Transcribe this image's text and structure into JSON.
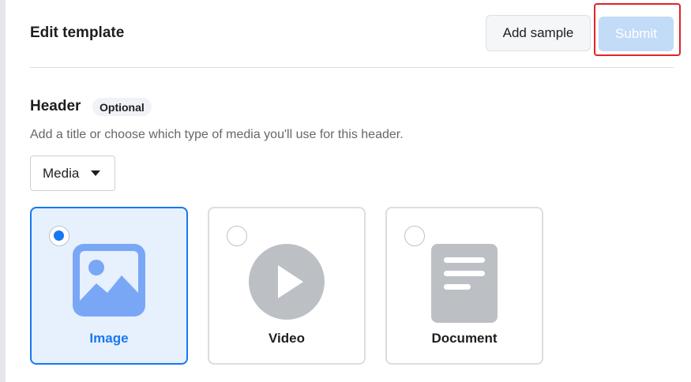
{
  "header": {
    "title": "Edit template",
    "add_sample_label": "Add sample",
    "submit_label": "Submit"
  },
  "section": {
    "title": "Header",
    "badge": "Optional",
    "helper": "Add a title or choose which type of media you'll use for this header.",
    "type_select": {
      "value": "Media"
    }
  },
  "media_options": [
    {
      "label": "Image",
      "icon": "image-icon",
      "selected": true
    },
    {
      "label": "Video",
      "icon": "play-icon",
      "selected": false
    },
    {
      "label": "Document",
      "icon": "document-icon",
      "selected": false
    }
  ],
  "colors": {
    "accent": "#1877f2",
    "selected_bg": "#e7f0fd",
    "submit_disabled": "#c2dbf7",
    "highlight": "#e02424",
    "icon_gray": "#bcc0c4"
  }
}
